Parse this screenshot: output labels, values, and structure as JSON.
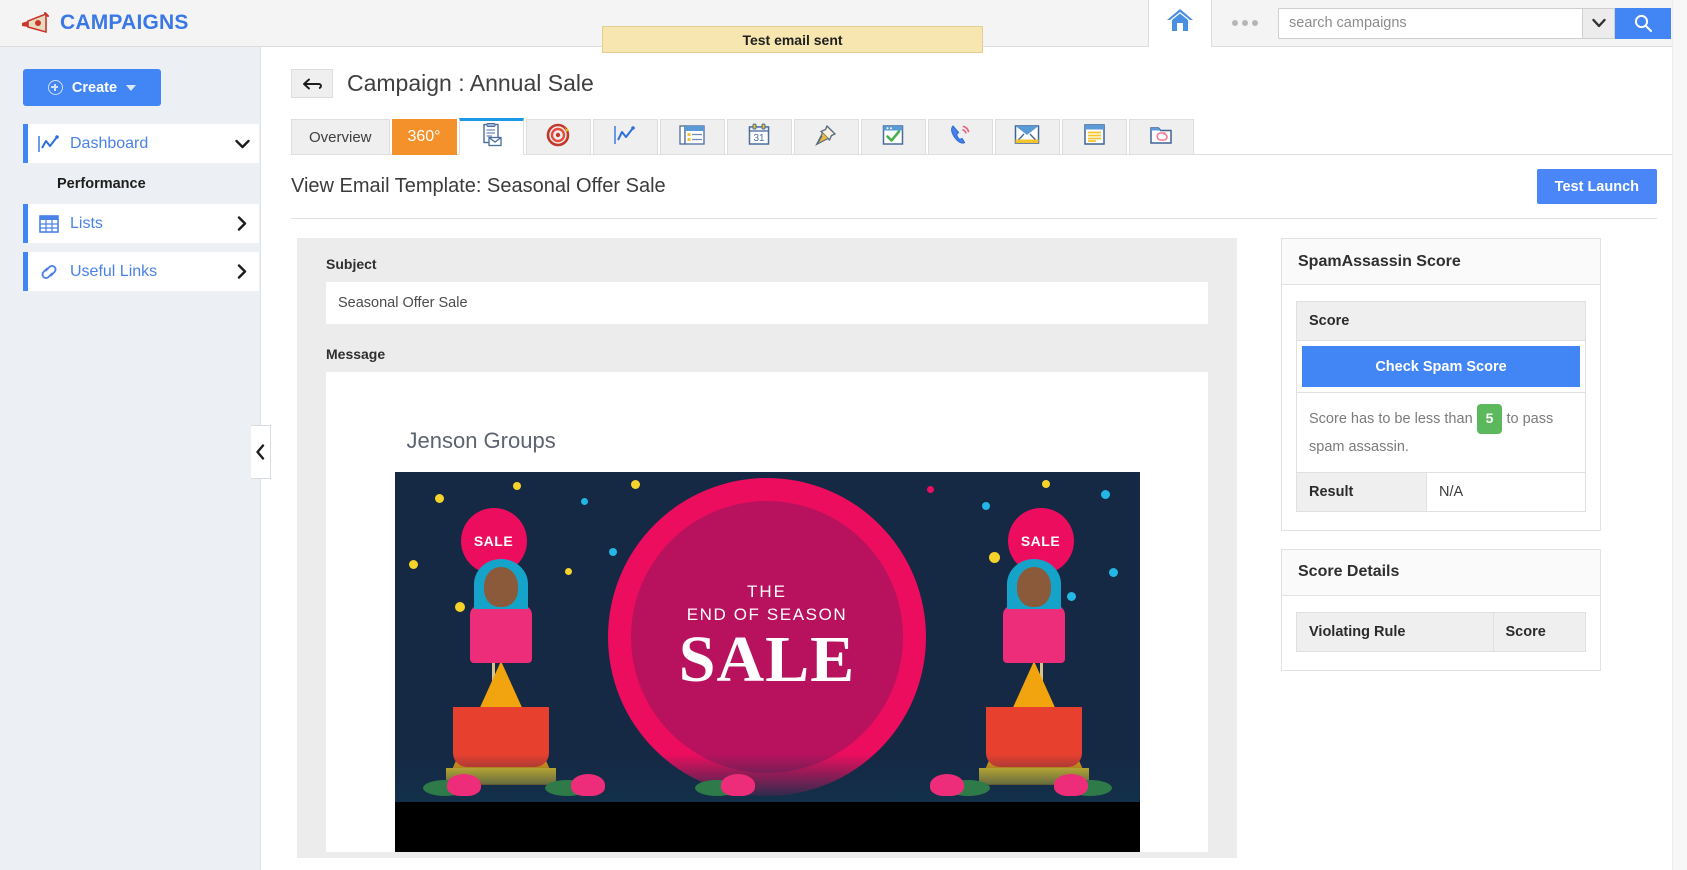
{
  "app": {
    "brand_title": "CAMPAIGNS",
    "brand_icon": "megaphone-icon"
  },
  "topbar": {
    "home_icon": "home-icon",
    "more_icon": "more-dots-icon",
    "search_placeholder": "search campaigns",
    "search_value": "",
    "search_dropdown_icon": "chevron-down-icon",
    "search_button_icon": "search-icon"
  },
  "notification": {
    "message": "Test email sent"
  },
  "sidebar": {
    "create_label": "Create",
    "create_icon": "plus-circle-icon",
    "create_caret": "caret-down-icon",
    "section_label": "Performance",
    "items": [
      {
        "label": "Dashboard",
        "icon": "chart-line-icon",
        "arrow": "chevron-down-icon"
      },
      {
        "label": "Lists",
        "icon": "grid-table-icon",
        "arrow": "chevron-right-icon"
      },
      {
        "label": "Useful Links",
        "icon": "link-icon",
        "arrow": "chevron-right-icon"
      }
    ],
    "collapse_icon": "chevron-left-icon"
  },
  "page": {
    "back_icon": "back-arrow-icon",
    "title": "Campaign : Annual Sale"
  },
  "tabs": [
    {
      "label": "Overview",
      "type": "text",
      "state": "normal",
      "name": "tab-overview"
    },
    {
      "label": "360°",
      "type": "text",
      "state": "highlight",
      "name": "tab-360"
    },
    {
      "label": "",
      "type": "icon",
      "state": "selected",
      "icon": "email-template-icon",
      "name": "tab-email-template"
    },
    {
      "label": "",
      "type": "icon",
      "state": "normal",
      "icon": "target-icon",
      "name": "tab-target"
    },
    {
      "label": "",
      "type": "icon",
      "state": "normal",
      "icon": "chart-line-icon",
      "name": "tab-analytics"
    },
    {
      "label": "",
      "type": "icon",
      "state": "normal",
      "icon": "news-list-icon",
      "name": "tab-content"
    },
    {
      "label": "",
      "type": "icon",
      "state": "normal",
      "icon": "calendar-icon",
      "name": "tab-calendar"
    },
    {
      "label": "",
      "type": "icon",
      "state": "normal",
      "icon": "pushpin-icon",
      "name": "tab-pinned"
    },
    {
      "label": "",
      "type": "icon",
      "state": "normal",
      "icon": "task-check-icon",
      "name": "tab-tasks"
    },
    {
      "label": "",
      "type": "icon",
      "state": "normal",
      "icon": "phone-call-icon",
      "name": "tab-calls"
    },
    {
      "label": "",
      "type": "icon",
      "state": "normal",
      "icon": "envelope-icon",
      "name": "tab-emails"
    },
    {
      "label": "",
      "type": "icon",
      "state": "normal",
      "icon": "notes-icon",
      "name": "tab-notes"
    },
    {
      "label": "",
      "type": "icon",
      "state": "normal",
      "icon": "attachment-folder-icon",
      "name": "tab-attachments"
    }
  ],
  "subhead": {
    "title": "View Email Template: Seasonal Offer Sale",
    "test_launch_label": "Test Launch"
  },
  "form": {
    "subject_label": "Subject",
    "subject_value": "Seasonal Offer Sale",
    "message_label": "Message"
  },
  "email_preview": {
    "brand": "Jenson Groups",
    "badge_left": "SALE",
    "badge_right": "SALE",
    "hero_line1": "THE",
    "hero_line2": "END OF SEASON",
    "hero_line3": "SALE"
  },
  "spam_panel": {
    "title": "SpamAssassin Score",
    "score_header": "Score",
    "check_button_label": "Check Spam Score",
    "hint_prefix": "Score has to be less than",
    "hint_value": "5",
    "hint_suffix": "to pass spam assassin.",
    "result_label": "Result",
    "result_value": "N/A"
  },
  "score_details_panel": {
    "title": "Score Details",
    "col_rule": "Violating Rule",
    "col_score": "Score"
  },
  "colors": {
    "accent_blue": "#4285f4",
    "tab_orange": "#f5912b",
    "banner_yellow": "#f7e6b0",
    "selected_tab_blue": "#1a9ae6",
    "badge_green": "#5cb85c",
    "hero_pink": "#ed0d5f",
    "hero_navy": "#152844"
  }
}
